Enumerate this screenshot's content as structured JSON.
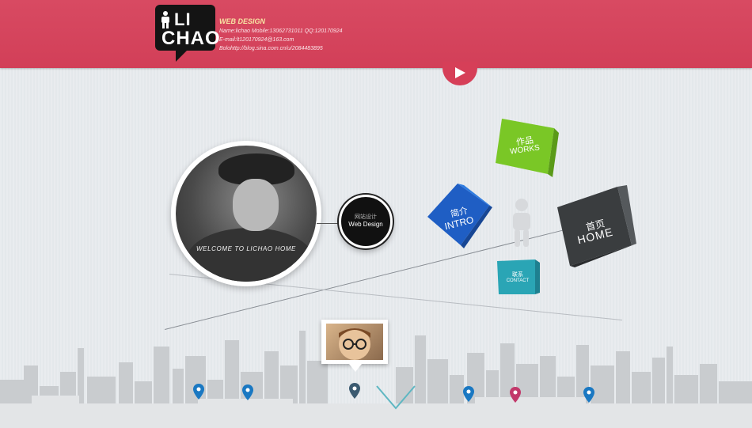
{
  "header": {
    "logo_line1": "LI",
    "logo_line2": "CHAO",
    "contact_title": "WEB DESIGN",
    "contact_line1": "Name:lichao    Mobile:13062731011    QQ:120170924",
    "contact_line2": "E-mail:lt120170924@163.com",
    "contact_line3": "Bolohttp://blog.sina.com.cn/u/2084483895"
  },
  "profile": {
    "welcome": "WELCOME TO LICHAO HOME",
    "badge_line1": "网站设计",
    "badge_line2": "Web Design"
  },
  "nav": {
    "works_cn": "作品",
    "works_en": "WORKS",
    "intro_cn": "简介",
    "intro_en": "INTRO",
    "home_cn": "首页",
    "home_en": "HOME",
    "contact_cn": "联系",
    "contact_en": "CONTACT"
  },
  "colors": {
    "header": "#d84a62",
    "works": "#7ac726",
    "intro": "#1f5ec4",
    "home": "#3a3d3f",
    "contact": "#2aa5b5"
  },
  "pins": [
    {
      "color": "#1a78c2"
    },
    {
      "color": "#1a78c2"
    },
    {
      "color": "#3b5a70"
    },
    {
      "color": "#1a78c2"
    },
    {
      "color": "#c2386a"
    },
    {
      "color": "#1a78c2"
    }
  ]
}
